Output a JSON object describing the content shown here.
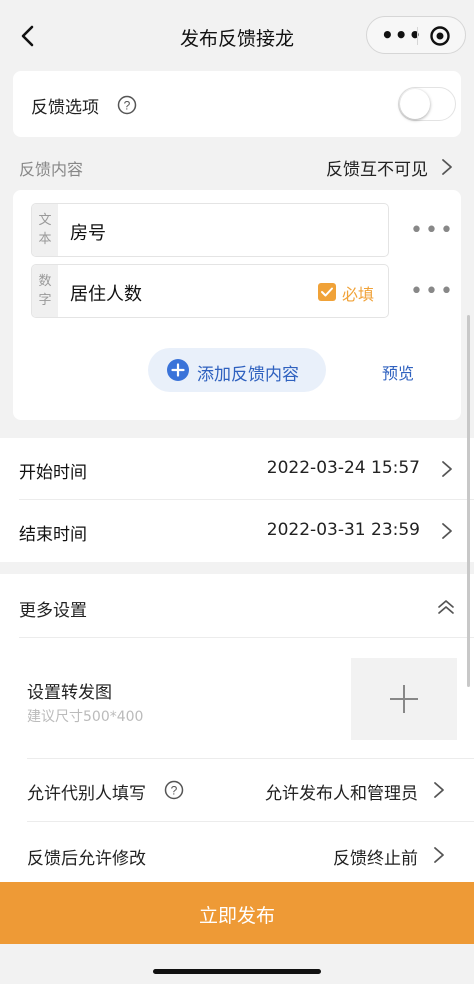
{
  "nav": {
    "title": "发布反馈接龙",
    "back_icon": "chevron-left-icon",
    "menu_icon": "more-dots-icon",
    "close_icon": "target-circle-icon"
  },
  "feedback_option": {
    "label": "反馈选项",
    "help_icon": "question-circle-icon",
    "toggle_on": false
  },
  "content_section": {
    "label": "反馈内容",
    "visibility": "反馈互不可见"
  },
  "fields": [
    {
      "type_label_1": "文",
      "type_label_2": "本",
      "name": "房号",
      "required": false
    },
    {
      "type_label_1": "数",
      "type_label_2": "字",
      "name": "居住人数",
      "required": true,
      "required_label": "必填"
    }
  ],
  "actions": {
    "add_label": "添加反馈内容",
    "preview_label": "预览"
  },
  "times": {
    "start_label": "开始时间",
    "start_value": "2022-03-24 15:57",
    "end_label": "结束时间",
    "end_value": "2022-03-31 23:59"
  },
  "more_settings": {
    "header": "更多设置",
    "forward_label": "设置转发图",
    "forward_hint": "建议尺寸500*400",
    "proxy_label": "允许代别人填写",
    "proxy_value": "允许发布人和管理员",
    "modify_label": "反馈后允许修改",
    "modify_value": "反馈终止前"
  },
  "submit_label": "立即发布",
  "colors": {
    "accent": "#ee9a36",
    "link": "#2f61bf",
    "plus_bg": "#3a73d9"
  }
}
